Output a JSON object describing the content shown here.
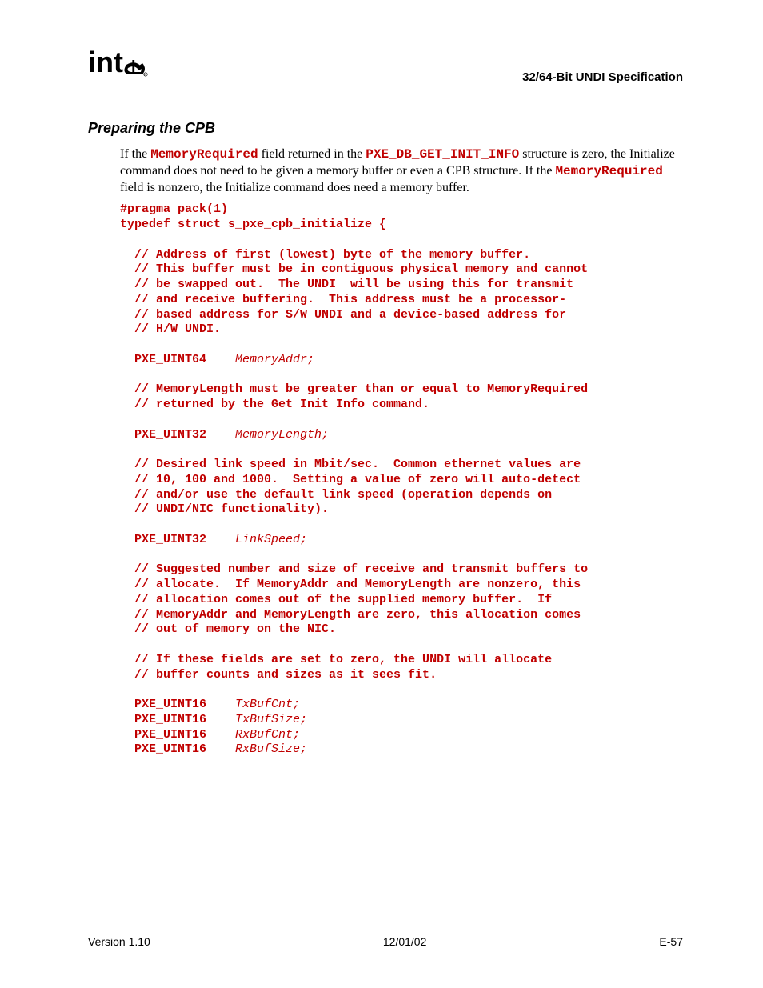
{
  "header": {
    "doc_title": "32/64-Bit UNDI Specification"
  },
  "section": {
    "heading": "Preparing the CPB"
  },
  "para": {
    "p1a": "If the ",
    "memreq1": "MemoryRequired",
    "p1b": " field returned in the ",
    "struct1": "PXE_DB_GET_INIT_INFO",
    "p1c": " structure is zero, the Initialize command does not need to be given a memory buffer or even a CPB structure.  If the ",
    "memreq2": "MemoryRequired",
    "p1d": " field is nonzero, the Initialize command does need a memory buffer."
  },
  "code": {
    "l01": "#pragma pack(1)",
    "l02": "typedef struct s_pxe_cpb_initialize {",
    "l03": "",
    "l04": "  // Address of first (lowest) byte of the memory buffer.",
    "l05": "  // This buffer must be in contiguous physical memory and cannot",
    "l06": "  // be swapped out.  The UNDI  will be using this for transmit",
    "l07": "  // and receive buffering.  This address must be a processor-",
    "l08": "  // based address for S/W UNDI and a device-based address for",
    "l09": "  // H/W UNDI.",
    "l10": "",
    "l11a": "  PXE_UINT64    ",
    "l11b": "MemoryAddr;",
    "l12": "",
    "l13": "  // MemoryLength must be greater than or equal to MemoryRequired",
    "l14": "  // returned by the Get Init Info command.",
    "l15": "",
    "l16a": "  PXE_UINT32    ",
    "l16b": "MemoryLength;",
    "l17": "",
    "l18": "  // Desired link speed in Mbit/sec.  Common ethernet values are",
    "l19": "  // 10, 100 and 1000.  Setting a value of zero will auto-detect",
    "l20": "  // and/or use the default link speed (operation depends on",
    "l21": "  // UNDI/NIC functionality).",
    "l22": "",
    "l23a": "  PXE_UINT32    ",
    "l23b": "LinkSpeed;",
    "l24": "",
    "l25": "  // Suggested number and size of receive and transmit buffers to",
    "l26": "  // allocate.  If MemoryAddr and MemoryLength are nonzero, this",
    "l27": "  // allocation comes out of the supplied memory buffer.  If",
    "l28": "  // MemoryAddr and MemoryLength are zero, this allocation comes",
    "l29": "  // out of memory on the NIC.",
    "l30": "",
    "l31": "  // If these fields are set to zero, the UNDI will allocate",
    "l32": "  // buffer counts and sizes as it sees fit.",
    "l33": "",
    "l34a": "  PXE_UINT16    ",
    "l34b": "TxBufCnt;",
    "l35a": "  PXE_UINT16    ",
    "l35b": "TxBufSize;",
    "l36a": "  PXE_UINT16    ",
    "l36b": "RxBufCnt;",
    "l37a": "  PXE_UINT16    ",
    "l37b": "RxBufSize;"
  },
  "footer": {
    "version": "Version 1.10",
    "date": "12/01/02",
    "page": "E-57"
  }
}
